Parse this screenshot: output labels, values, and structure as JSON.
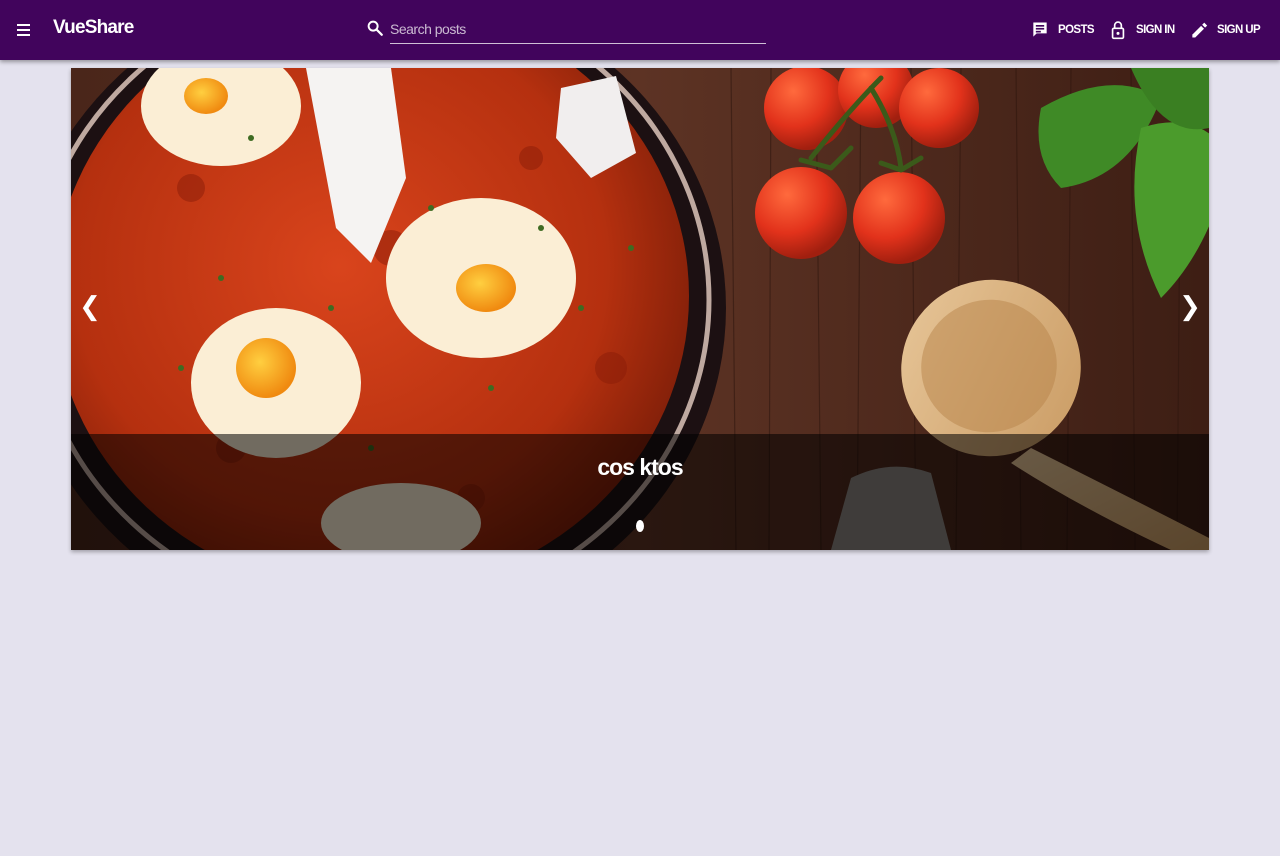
{
  "toolbar": {
    "menu_icon": "hamburger-icon",
    "brand": "VueShare",
    "search": {
      "placeholder": "Search posts",
      "value": "",
      "icon": "search-icon"
    },
    "nav": [
      {
        "label": "POSTS",
        "icon": "posts-icon"
      },
      {
        "label": "SIGN IN",
        "icon": "lock-icon"
      },
      {
        "label": "SIGN UP",
        "icon": "pencil-icon"
      }
    ],
    "color": "#41045c"
  },
  "carousel": {
    "slide_title": "cos ktos",
    "prev_icon": "chevron-left-icon",
    "next_icon": "chevron-right-icon",
    "prev_glyph": "❮",
    "next_glyph": "❯",
    "slide_count": 1,
    "active_slide": 1
  },
  "page": {
    "background": "#e4e2ee"
  }
}
